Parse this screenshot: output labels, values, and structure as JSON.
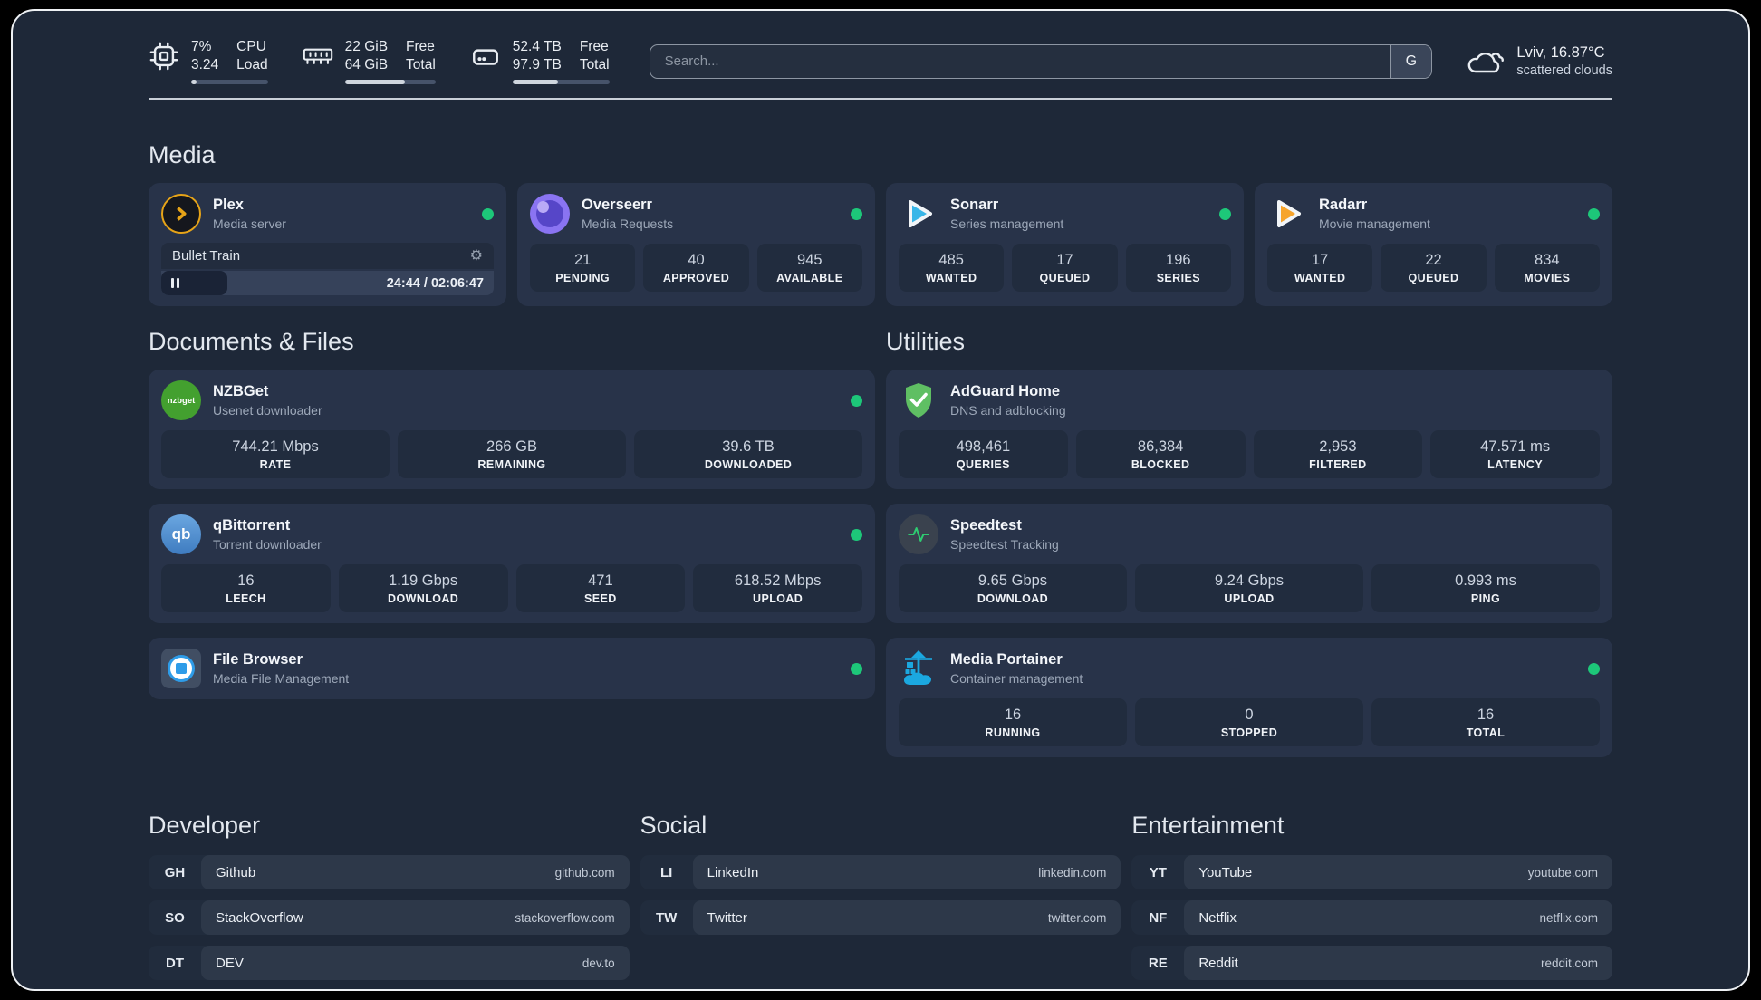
{
  "colors": {
    "status_online": "#1dc779",
    "plex_accent": "#e7a418",
    "sonarr_accent": "#38b6e8",
    "radarr_accent": "#f6a42c",
    "nzbget_green": "#43a02f",
    "qbittorrent_blue": "#4f8fd0",
    "adguard_green": "#5fbf63",
    "speedtest_green": "#2ecc71",
    "portainer_blue": "#1ba8e0",
    "overseerr_purple": "#8a74f2"
  },
  "topbar": {
    "cpu": {
      "icon": "cpu-chip-icon",
      "value_top": "7%",
      "value_bottom": "3.24",
      "label_top": "CPU",
      "label_bottom": "Load",
      "progress_pct": 7
    },
    "ram": {
      "icon": "ram-icon",
      "value_top": "22 GiB",
      "value_bottom": "64 GiB",
      "label_top": "Free",
      "label_bottom": "Total",
      "progress_pct": 66
    },
    "disk": {
      "icon": "hard-drive-icon",
      "value_top": "52.4 TB",
      "value_bottom": "97.9 TB",
      "label_top": "Free",
      "label_bottom": "Total",
      "progress_pct": 47
    },
    "search": {
      "placeholder": "Search...",
      "button_label": "G"
    },
    "weather": {
      "icon": "cloud-icon",
      "location_temp": "Lviv, 16.87°C",
      "condition": "scattered clouds"
    }
  },
  "sections": {
    "media": {
      "title": "Media",
      "plex": {
        "name": "Plex",
        "subtitle": "Media server",
        "icon": "plex-icon",
        "online": true,
        "player": {
          "title": "Bullet Train",
          "time": "24:44 / 02:06:47",
          "progress_pct": 20
        }
      },
      "overseerr": {
        "name": "Overseerr",
        "subtitle": "Media Requests",
        "icon": "overseerr-icon",
        "online": true,
        "stats": [
          {
            "value": "21",
            "label": "PENDING"
          },
          {
            "value": "40",
            "label": "APPROVED"
          },
          {
            "value": "945",
            "label": "AVAILABLE"
          }
        ]
      },
      "sonarr": {
        "name": "Sonarr",
        "subtitle": "Series management",
        "icon": "sonarr-icon",
        "online": true,
        "stats": [
          {
            "value": "485",
            "label": "WANTED"
          },
          {
            "value": "17",
            "label": "QUEUED"
          },
          {
            "value": "196",
            "label": "SERIES"
          }
        ]
      },
      "radarr": {
        "name": "Radarr",
        "subtitle": "Movie management",
        "icon": "radarr-icon",
        "online": true,
        "stats": [
          {
            "value": "17",
            "label": "WANTED"
          },
          {
            "value": "22",
            "label": "QUEUED"
          },
          {
            "value": "834",
            "label": "MOVIES"
          }
        ]
      }
    },
    "documents": {
      "title": "Documents & Files",
      "nzbget": {
        "name": "NZBGet",
        "subtitle": "Usenet downloader",
        "icon": "nzbget-icon",
        "icon_text": "nzbget",
        "online": true,
        "stats": [
          {
            "value": "744.21 Mbps",
            "label": "RATE"
          },
          {
            "value": "266 GB",
            "label": "REMAINING"
          },
          {
            "value": "39.6 TB",
            "label": "DOWNLOADED"
          }
        ]
      },
      "qbittorrent": {
        "name": "qBittorrent",
        "subtitle": "Torrent downloader",
        "icon": "qbittorrent-icon",
        "icon_text": "qb",
        "online": true,
        "stats": [
          {
            "value": "16",
            "label": "LEECH"
          },
          {
            "value": "1.19 Gbps",
            "label": "DOWNLOAD"
          },
          {
            "value": "471",
            "label": "SEED"
          },
          {
            "value": "618.52 Mbps",
            "label": "UPLOAD"
          }
        ]
      },
      "filebrowser": {
        "name": "File Browser",
        "subtitle": "Media File Management",
        "icon": "filebrowser-icon",
        "online": true
      }
    },
    "utilities": {
      "title": "Utilities",
      "adguard": {
        "name": "AdGuard Home",
        "subtitle": "DNS and adblocking",
        "icon": "adguard-shield-icon",
        "online": false,
        "stats": [
          {
            "value": "498,461",
            "label": "QUERIES"
          },
          {
            "value": "86,384",
            "label": "BLOCKED"
          },
          {
            "value": "2,953",
            "label": "FILTERED"
          },
          {
            "value": "47.571 ms",
            "label": "LATENCY"
          }
        ]
      },
      "speedtest": {
        "name": "Speedtest",
        "subtitle": "Speedtest Tracking",
        "icon": "speedtest-pulse-icon",
        "online": false,
        "stats": [
          {
            "value": "9.65 Gbps",
            "label": "DOWNLOAD"
          },
          {
            "value": "9.24 Gbps",
            "label": "UPLOAD"
          },
          {
            "value": "0.993 ms",
            "label": "PING"
          }
        ]
      },
      "portainer": {
        "name": "Media Portainer",
        "subtitle": "Container management",
        "icon": "portainer-crane-icon",
        "online": true,
        "stats": [
          {
            "value": "16",
            "label": "RUNNING"
          },
          {
            "value": "0",
            "label": "STOPPED"
          },
          {
            "value": "16",
            "label": "TOTAL"
          }
        ]
      }
    },
    "developer": {
      "title": "Developer",
      "links": [
        {
          "abbr": "GH",
          "name": "Github",
          "url": "github.com"
        },
        {
          "abbr": "SO",
          "name": "StackOverflow",
          "url": "stackoverflow.com"
        },
        {
          "abbr": "DT",
          "name": "DEV",
          "url": "dev.to"
        }
      ]
    },
    "social": {
      "title": "Social",
      "links": [
        {
          "abbr": "LI",
          "name": "LinkedIn",
          "url": "linkedin.com"
        },
        {
          "abbr": "TW",
          "name": "Twitter",
          "url": "twitter.com"
        }
      ]
    },
    "entertainment": {
      "title": "Entertainment",
      "links": [
        {
          "abbr": "YT",
          "name": "YouTube",
          "url": "youtube.com"
        },
        {
          "abbr": "NF",
          "name": "Netflix",
          "url": "netflix.com"
        },
        {
          "abbr": "RE",
          "name": "Reddit",
          "url": "reddit.com"
        }
      ]
    }
  }
}
